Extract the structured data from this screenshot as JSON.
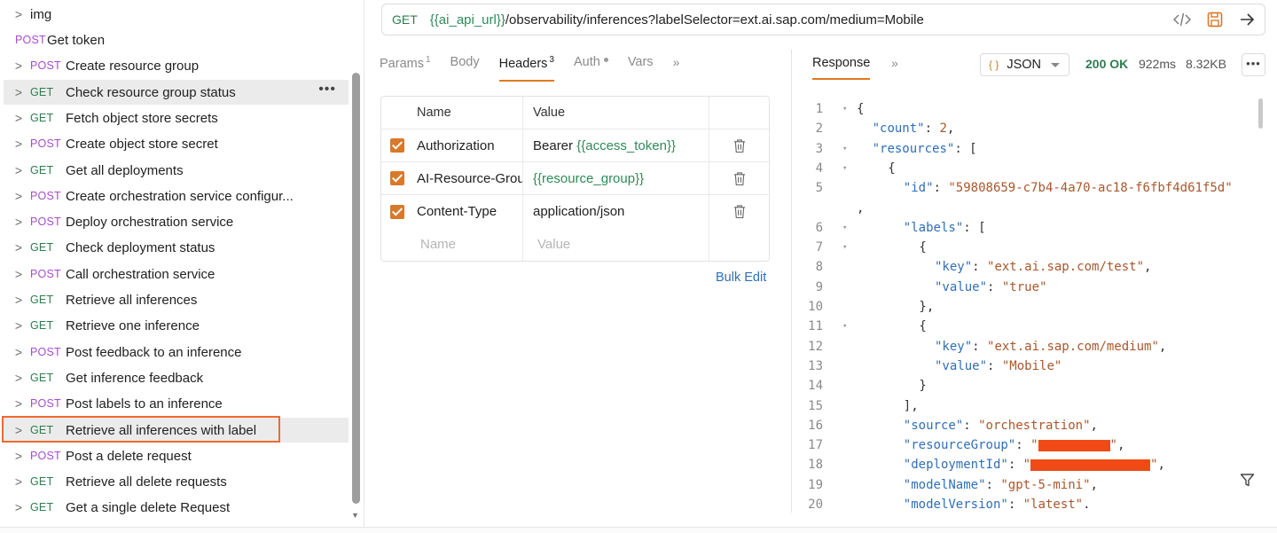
{
  "sidebar": {
    "folder": {
      "label": "img"
    },
    "items": [
      {
        "method": "POST",
        "label": "Get token"
      },
      {
        "method": "POST",
        "label": "Create resource group"
      },
      {
        "method": "GET",
        "label": "Check resource group status"
      },
      {
        "method": "GET",
        "label": "Fetch object store secrets"
      },
      {
        "method": "POST",
        "label": "Create object store secret"
      },
      {
        "method": "GET",
        "label": "Get all deployments"
      },
      {
        "method": "POST",
        "label": "Create orchestration service configur..."
      },
      {
        "method": "POST",
        "label": "Deploy orchestration service"
      },
      {
        "method": "GET",
        "label": "Check deployment status"
      },
      {
        "method": "POST",
        "label": "Call orchestration service"
      },
      {
        "method": "GET",
        "label": "Retrieve all inferences"
      },
      {
        "method": "GET",
        "label": "Retrieve one inference"
      },
      {
        "method": "POST",
        "label": "Post feedback to an inference"
      },
      {
        "method": "GET",
        "label": "Get inference feedback"
      },
      {
        "method": "POST",
        "label": "Post labels to an inference"
      },
      {
        "method": "GET",
        "label": "Retrieve all inferences with label"
      },
      {
        "method": "POST",
        "label": "Post a delete request"
      },
      {
        "method": "GET",
        "label": "Retrieve all delete requests"
      },
      {
        "method": "GET",
        "label": "Get a single delete Request"
      }
    ],
    "more_label": "•••"
  },
  "request": {
    "method": "GET",
    "url_var": "{{ai_api_url}}",
    "url_path": "/observability/inferences?labelSelector=ext.ai.sap.com/medium=Mobile",
    "tabs": [
      {
        "label": "Params",
        "badge": "1"
      },
      {
        "label": "Body",
        "badge": ""
      },
      {
        "label": "Headers",
        "badge": "3"
      },
      {
        "label": "Auth",
        "badge": ""
      },
      {
        "label": "Vars",
        "badge": ""
      }
    ],
    "tabs_more": "»",
    "headers_table": {
      "col_name": "Name",
      "col_value": "Value",
      "rows": [
        {
          "key": "Authorization",
          "value_prefix": "Bearer ",
          "value_var": "{{access_token}}"
        },
        {
          "key": "AI-Resource-Group",
          "value_prefix": "",
          "value_var": "{{resource_group}}"
        },
        {
          "key": "Content-Type",
          "value_prefix": "application/json",
          "value_var": ""
        }
      ],
      "placeholder_name": "Name",
      "placeholder_value": "Value"
    },
    "bulk_edit": "Bulk Edit"
  },
  "response": {
    "tab": "Response",
    "tabs_more": "»",
    "format": "JSON",
    "format_icon": "{ }",
    "status": "200 OK",
    "time": "922ms",
    "size": "8.32KB",
    "more_label": "•••",
    "code_lines": [
      {
        "n": "1",
        "fold": true,
        "indent": 0,
        "parts": [
          {
            "t": "p",
            "v": "{"
          }
        ]
      },
      {
        "n": "2",
        "fold": false,
        "indent": 1,
        "parts": [
          {
            "t": "k",
            "v": "\"count\""
          },
          {
            "t": "p",
            "v": ": "
          },
          {
            "t": "n",
            "v": "2"
          },
          {
            "t": "p",
            "v": ","
          }
        ]
      },
      {
        "n": "3",
        "fold": true,
        "indent": 1,
        "parts": [
          {
            "t": "k",
            "v": "\"resources\""
          },
          {
            "t": "p",
            "v": ": ["
          }
        ]
      },
      {
        "n": "4",
        "fold": true,
        "indent": 2,
        "parts": [
          {
            "t": "p",
            "v": "{"
          }
        ]
      },
      {
        "n": "5",
        "fold": false,
        "indent": 3,
        "parts": [
          {
            "t": "k",
            "v": "\"id\""
          },
          {
            "t": "p",
            "v": ": "
          },
          {
            "t": "s",
            "v": "\"59808659-c7b4-4a70-ac18-f6fbf4d61f5d\""
          }
        ]
      },
      {
        "n": "",
        "fold": false,
        "indent": 0,
        "parts": [
          {
            "t": "p",
            "v": ","
          }
        ]
      },
      {
        "n": "6",
        "fold": true,
        "indent": 3,
        "parts": [
          {
            "t": "k",
            "v": "\"labels\""
          },
          {
            "t": "p",
            "v": ": ["
          }
        ]
      },
      {
        "n": "7",
        "fold": true,
        "indent": 4,
        "parts": [
          {
            "t": "p",
            "v": "{"
          }
        ]
      },
      {
        "n": "8",
        "fold": false,
        "indent": 5,
        "parts": [
          {
            "t": "k",
            "v": "\"key\""
          },
          {
            "t": "p",
            "v": ": "
          },
          {
            "t": "s",
            "v": "\"ext.ai.sap.com/test\""
          },
          {
            "t": "p",
            "v": ","
          }
        ]
      },
      {
        "n": "9",
        "fold": false,
        "indent": 5,
        "parts": [
          {
            "t": "k",
            "v": "\"value\""
          },
          {
            "t": "p",
            "v": ": "
          },
          {
            "t": "s",
            "v": "\"true\""
          }
        ]
      },
      {
        "n": "10",
        "fold": false,
        "indent": 4,
        "parts": [
          {
            "t": "p",
            "v": "},"
          }
        ]
      },
      {
        "n": "11",
        "fold": true,
        "indent": 4,
        "parts": [
          {
            "t": "p",
            "v": "{"
          }
        ]
      },
      {
        "n": "12",
        "fold": false,
        "indent": 5,
        "parts": [
          {
            "t": "k",
            "v": "\"key\""
          },
          {
            "t": "p",
            "v": ": "
          },
          {
            "t": "s",
            "v": "\"ext.ai.sap.com/medium\""
          },
          {
            "t": "p",
            "v": ","
          }
        ]
      },
      {
        "n": "13",
        "fold": false,
        "indent": 5,
        "parts": [
          {
            "t": "k",
            "v": "\"value\""
          },
          {
            "t": "p",
            "v": ": "
          },
          {
            "t": "s",
            "v": "\"Mobile\""
          }
        ]
      },
      {
        "n": "14",
        "fold": false,
        "indent": 4,
        "parts": [
          {
            "t": "p",
            "v": "}"
          }
        ]
      },
      {
        "n": "15",
        "fold": false,
        "indent": 3,
        "parts": [
          {
            "t": "p",
            "v": "],"
          }
        ]
      },
      {
        "n": "16",
        "fold": false,
        "indent": 3,
        "parts": [
          {
            "t": "k",
            "v": "\"source\""
          },
          {
            "t": "p",
            "v": ": "
          },
          {
            "t": "s",
            "v": "\"orchestration\""
          },
          {
            "t": "p",
            "v": ","
          }
        ]
      },
      {
        "n": "17",
        "fold": false,
        "indent": 3,
        "parts": [
          {
            "t": "k",
            "v": "\"resourceGroup\""
          },
          {
            "t": "p",
            "v": ": "
          },
          {
            "t": "s",
            "v": "\""
          },
          {
            "t": "r",
            "v": "9"
          },
          {
            "t": "s",
            "v": "\""
          },
          {
            "t": "p",
            "v": ","
          }
        ]
      },
      {
        "n": "18",
        "fold": false,
        "indent": 3,
        "parts": [
          {
            "t": "k",
            "v": "\"deploymentId\""
          },
          {
            "t": "p",
            "v": ": "
          },
          {
            "t": "s",
            "v": "\""
          },
          {
            "t": "r",
            "v": "15"
          },
          {
            "t": "s",
            "v": "\""
          },
          {
            "t": "p",
            "v": ","
          }
        ]
      },
      {
        "n": "19",
        "fold": false,
        "indent": 3,
        "parts": [
          {
            "t": "k",
            "v": "\"modelName\""
          },
          {
            "t": "p",
            "v": ": "
          },
          {
            "t": "s",
            "v": "\"gpt-5-mini\""
          },
          {
            "t": "p",
            "v": ","
          }
        ]
      },
      {
        "n": "20",
        "fold": false,
        "indent": 3,
        "parts": [
          {
            "t": "k",
            "v": "\"modelVersion\""
          },
          {
            "t": "p",
            "v": ": "
          },
          {
            "t": "s",
            "v": "\"latest\""
          },
          {
            "t": "p",
            "v": "."
          }
        ]
      }
    ]
  },
  "colors": {
    "post": "#a74ccf",
    "get": "#2e7d4f",
    "accent": "#e07a1f",
    "selection_outline": "#ef6a2c",
    "redaction": "#f04b16"
  }
}
